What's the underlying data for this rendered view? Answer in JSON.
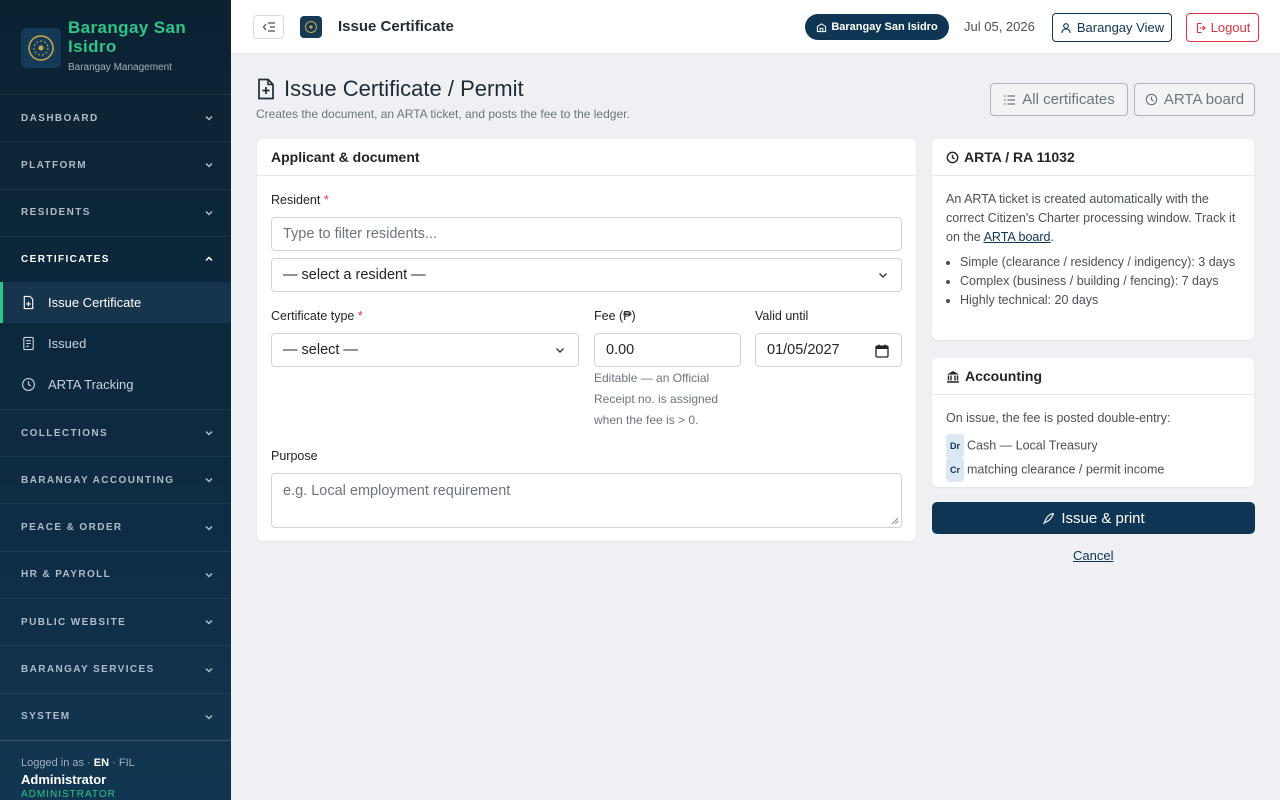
{
  "sidebar": {
    "brand_name": "Barangay San Isidro",
    "brand_sub": "Barangay Management",
    "sections": {
      "dashboard": "DASHBOARD",
      "platform": "PLATFORM",
      "residents": "RESIDENTS",
      "certificates": "CERTIFICATES",
      "collections": "COLLECTIONS",
      "accounting": "BARANGAY ACCOUNTING",
      "peace": "PEACE & ORDER",
      "hr": "HR & PAYROLL",
      "website": "PUBLIC WEBSITE",
      "services": "BARANGAY SERVICES",
      "system": "SYSTEM"
    },
    "cert_items": [
      "Issue Certificate",
      "Issued",
      "ARTA Tracking"
    ],
    "user": {
      "logged_in_as": "Logged in as ·",
      "lang_en": "EN",
      "lang_fil": "· FIL",
      "name": "Administrator",
      "role": "ADMINISTRATOR"
    }
  },
  "topbar": {
    "title": "Issue Certificate",
    "barangay_pill": "Barangay San Isidro",
    "date": "Jul 05, 2026",
    "view_button": "Barangay View",
    "logout_button": "Logout"
  },
  "page": {
    "title": "Issue Certificate / Permit",
    "subtitle": "Creates the document, an ARTA ticket, and posts the fee to the ledger.",
    "all_certs_button": "All certificates",
    "arta_board_button": "ARTA board"
  },
  "form": {
    "card_title": "Applicant & document",
    "resident_label": "Resident",
    "required_mark": "*",
    "resident_filter_placeholder": "Type to filter residents...",
    "resident_select": "— select a resident —",
    "cert_type_label": "Certificate type",
    "cert_type_select": "— select —",
    "fee_label": "Fee (₱)",
    "fee_value": "0.00",
    "fee_help": "Editable — an Official Receipt no. is assigned when the fee is > 0.",
    "valid_label": "Valid until",
    "valid_value": "01/05/2027",
    "purpose_label": "Purpose",
    "purpose_placeholder": "e.g. Local employment requirement"
  },
  "arta": {
    "title": "ARTA / RA 11032",
    "text1": "An ARTA ticket is created automatically with the correct Citizen's Charter processing window. Track it on the",
    "link": "ARTA board",
    "text2": ".",
    "items": [
      "Simple (clearance / residency / indigency): 3 days",
      "Complex (business / building / fencing): 7 days",
      "Highly technical: 20 days"
    ]
  },
  "accounting": {
    "title": "Accounting",
    "text": "On issue, the fee is posted double-entry:",
    "dr_badge": "Dr",
    "dr_text": "Cash — Local Treasury",
    "cr_badge": "Cr",
    "cr_text": "matching clearance / permit income"
  },
  "actions": {
    "issue_button": "Issue & print",
    "cancel_link": "Cancel"
  },
  "colors": {
    "brand_green": "#2fc587",
    "primary_navy": "#0f3554",
    "danger": "#dc3545"
  }
}
